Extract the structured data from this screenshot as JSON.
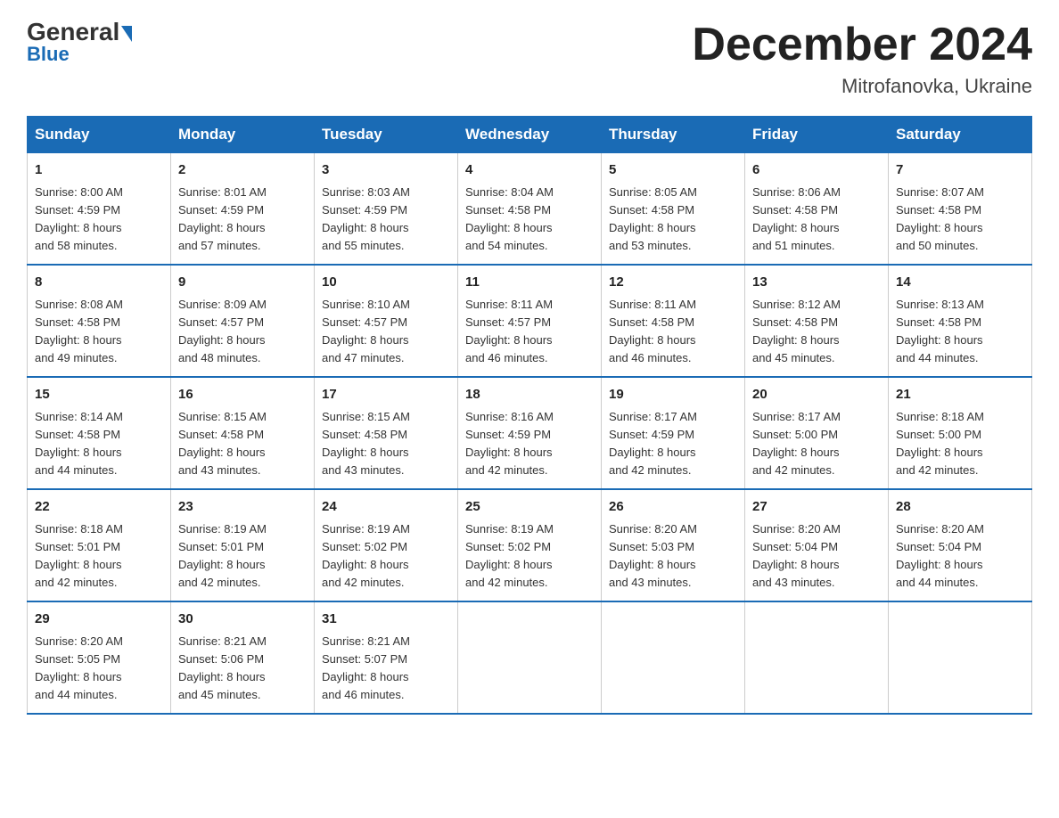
{
  "header": {
    "logo_general": "General",
    "logo_blue": "Blue",
    "month_title": "December 2024",
    "location": "Mitrofanovka, Ukraine"
  },
  "days_of_week": [
    "Sunday",
    "Monday",
    "Tuesday",
    "Wednesday",
    "Thursday",
    "Friday",
    "Saturday"
  ],
  "weeks": [
    [
      {
        "day": "1",
        "sunrise": "8:00 AM",
        "sunset": "4:59 PM",
        "daylight": "8 hours and 58 minutes."
      },
      {
        "day": "2",
        "sunrise": "8:01 AM",
        "sunset": "4:59 PM",
        "daylight": "8 hours and 57 minutes."
      },
      {
        "day": "3",
        "sunrise": "8:03 AM",
        "sunset": "4:59 PM",
        "daylight": "8 hours and 55 minutes."
      },
      {
        "day": "4",
        "sunrise": "8:04 AM",
        "sunset": "4:58 PM",
        "daylight": "8 hours and 54 minutes."
      },
      {
        "day": "5",
        "sunrise": "8:05 AM",
        "sunset": "4:58 PM",
        "daylight": "8 hours and 53 minutes."
      },
      {
        "day": "6",
        "sunrise": "8:06 AM",
        "sunset": "4:58 PM",
        "daylight": "8 hours and 51 minutes."
      },
      {
        "day": "7",
        "sunrise": "8:07 AM",
        "sunset": "4:58 PM",
        "daylight": "8 hours and 50 minutes."
      }
    ],
    [
      {
        "day": "8",
        "sunrise": "8:08 AM",
        "sunset": "4:58 PM",
        "daylight": "8 hours and 49 minutes."
      },
      {
        "day": "9",
        "sunrise": "8:09 AM",
        "sunset": "4:57 PM",
        "daylight": "8 hours and 48 minutes."
      },
      {
        "day": "10",
        "sunrise": "8:10 AM",
        "sunset": "4:57 PM",
        "daylight": "8 hours and 47 minutes."
      },
      {
        "day": "11",
        "sunrise": "8:11 AM",
        "sunset": "4:57 PM",
        "daylight": "8 hours and 46 minutes."
      },
      {
        "day": "12",
        "sunrise": "8:11 AM",
        "sunset": "4:58 PM",
        "daylight": "8 hours and 46 minutes."
      },
      {
        "day": "13",
        "sunrise": "8:12 AM",
        "sunset": "4:58 PM",
        "daylight": "8 hours and 45 minutes."
      },
      {
        "day": "14",
        "sunrise": "8:13 AM",
        "sunset": "4:58 PM",
        "daylight": "8 hours and 44 minutes."
      }
    ],
    [
      {
        "day": "15",
        "sunrise": "8:14 AM",
        "sunset": "4:58 PM",
        "daylight": "8 hours and 44 minutes."
      },
      {
        "day": "16",
        "sunrise": "8:15 AM",
        "sunset": "4:58 PM",
        "daylight": "8 hours and 43 minutes."
      },
      {
        "day": "17",
        "sunrise": "8:15 AM",
        "sunset": "4:58 PM",
        "daylight": "8 hours and 43 minutes."
      },
      {
        "day": "18",
        "sunrise": "8:16 AM",
        "sunset": "4:59 PM",
        "daylight": "8 hours and 42 minutes."
      },
      {
        "day": "19",
        "sunrise": "8:17 AM",
        "sunset": "4:59 PM",
        "daylight": "8 hours and 42 minutes."
      },
      {
        "day": "20",
        "sunrise": "8:17 AM",
        "sunset": "5:00 PM",
        "daylight": "8 hours and 42 minutes."
      },
      {
        "day": "21",
        "sunrise": "8:18 AM",
        "sunset": "5:00 PM",
        "daylight": "8 hours and 42 minutes."
      }
    ],
    [
      {
        "day": "22",
        "sunrise": "8:18 AM",
        "sunset": "5:01 PM",
        "daylight": "8 hours and 42 minutes."
      },
      {
        "day": "23",
        "sunrise": "8:19 AM",
        "sunset": "5:01 PM",
        "daylight": "8 hours and 42 minutes."
      },
      {
        "day": "24",
        "sunrise": "8:19 AM",
        "sunset": "5:02 PM",
        "daylight": "8 hours and 42 minutes."
      },
      {
        "day": "25",
        "sunrise": "8:19 AM",
        "sunset": "5:02 PM",
        "daylight": "8 hours and 42 minutes."
      },
      {
        "day": "26",
        "sunrise": "8:20 AM",
        "sunset": "5:03 PM",
        "daylight": "8 hours and 43 minutes."
      },
      {
        "day": "27",
        "sunrise": "8:20 AM",
        "sunset": "5:04 PM",
        "daylight": "8 hours and 43 minutes."
      },
      {
        "day": "28",
        "sunrise": "8:20 AM",
        "sunset": "5:04 PM",
        "daylight": "8 hours and 44 minutes."
      }
    ],
    [
      {
        "day": "29",
        "sunrise": "8:20 AM",
        "sunset": "5:05 PM",
        "daylight": "8 hours and 44 minutes."
      },
      {
        "day": "30",
        "sunrise": "8:21 AM",
        "sunset": "5:06 PM",
        "daylight": "8 hours and 45 minutes."
      },
      {
        "day": "31",
        "sunrise": "8:21 AM",
        "sunset": "5:07 PM",
        "daylight": "8 hours and 46 minutes."
      },
      null,
      null,
      null,
      null
    ]
  ],
  "labels": {
    "sunrise": "Sunrise:",
    "sunset": "Sunset:",
    "daylight": "Daylight:"
  }
}
